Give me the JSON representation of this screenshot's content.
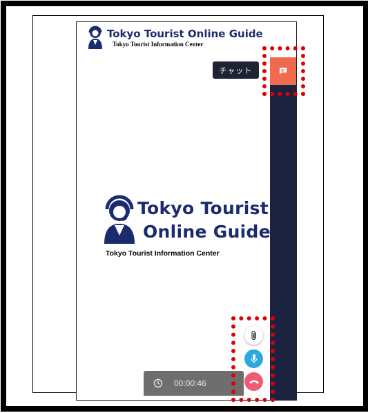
{
  "header_logo": {
    "brand": "Tokyo Tourist Online Guide",
    "subtitle": "Tokyo Tourist Information Center"
  },
  "center_logo": {
    "line1": "Tokyo Tourist",
    "line2": "Online Guide",
    "subtitle": "Tokyo Tourist Information Center"
  },
  "chat_button": {
    "label": "チャット"
  },
  "chat_tab": {
    "icon": "chat-bubble-icon"
  },
  "call_controls": {
    "attach_icon": "paperclip-icon",
    "mic_icon": "microphone-icon",
    "hangup_icon": "phone-hangup-icon"
  },
  "timer": {
    "icon": "clock-icon",
    "elapsed": "00:00:46"
  },
  "colors": {
    "brand_navy": "#1c2b6e",
    "side_panel": "#1b2340",
    "chat_tab": "#f06b4e",
    "mic_button": "#2ea6e0",
    "hangup_button": "#ef5b73",
    "highlight": "#e00000"
  }
}
